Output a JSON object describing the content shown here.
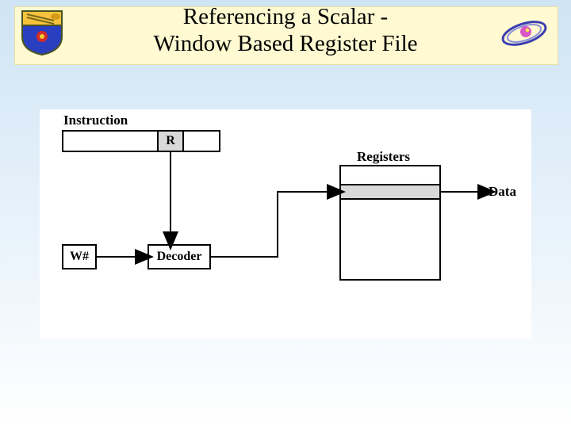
{
  "title_line1": "Referencing a Scalar -",
  "title_line2": "Window Based Register File",
  "labels": {
    "instruction": "Instruction",
    "registers": "Registers",
    "data": "Data",
    "r": "R",
    "wnum": "W#",
    "decoder": "Decoder"
  }
}
